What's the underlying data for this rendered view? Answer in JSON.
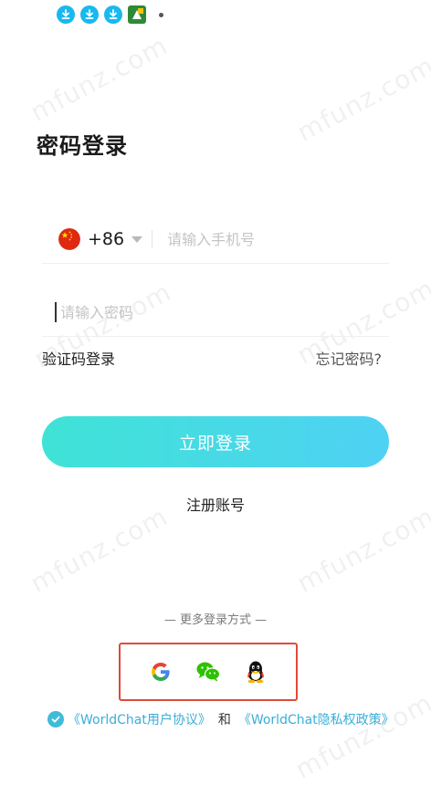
{
  "status_bar": {
    "icons": [
      "download-icon",
      "download-icon",
      "download-icon",
      "app-icon"
    ]
  },
  "watermark": "mfunz.com",
  "title": "密码登录",
  "phone": {
    "country_code": "+86",
    "flag": "china-flag-icon",
    "placeholder": "请输入手机号",
    "value": ""
  },
  "password": {
    "placeholder": "请输入密码",
    "value": ""
  },
  "links": {
    "sms_login": "验证码登录",
    "forgot": "忘记密码?"
  },
  "login_button": "立即登录",
  "register": "注册账号",
  "more_login_title": "— 更多登录方式 —",
  "social": [
    {
      "name": "google",
      "icon": "google-icon"
    },
    {
      "name": "wechat",
      "icon": "wechat-icon"
    },
    {
      "name": "qq",
      "icon": "qq-icon"
    }
  ],
  "agreement": {
    "checked": true,
    "user_agreement": "《WorldChat用户协议》",
    "and": "和",
    "privacy_policy": "《WorldChat隐私权政策》"
  },
  "colors": {
    "accent_start": "#3fe3d6",
    "accent_end": "#4fd1f4",
    "link": "#3aaed8",
    "highlight_box": "#e04a35"
  }
}
